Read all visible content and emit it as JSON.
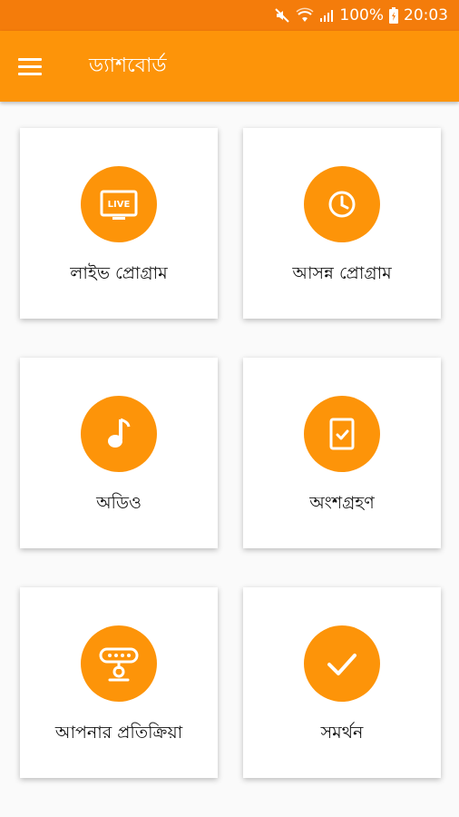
{
  "statusbar": {
    "battery": "100%",
    "time": "20:03"
  },
  "appbar": {
    "title": "ড্যাশবোর্ড"
  },
  "colors": {
    "primary": "#fd9409",
    "statusbar": "#f47c0b"
  },
  "cards": [
    {
      "label": "লাইভ প্রোগ্রাম",
      "icon": "live-tv-icon",
      "badge": "LIVE"
    },
    {
      "label": "আসন্ন প্রোগ্রাম",
      "icon": "clock-icon"
    },
    {
      "label": "অডিও",
      "icon": "music-note-icon"
    },
    {
      "label": "অংশগ্রহণ",
      "icon": "checklist-icon"
    },
    {
      "label": "আপনার প্রতিক্রিয়া",
      "icon": "webcam-icon"
    },
    {
      "label": "সমর্থন",
      "icon": "checkmark-icon"
    }
  ]
}
